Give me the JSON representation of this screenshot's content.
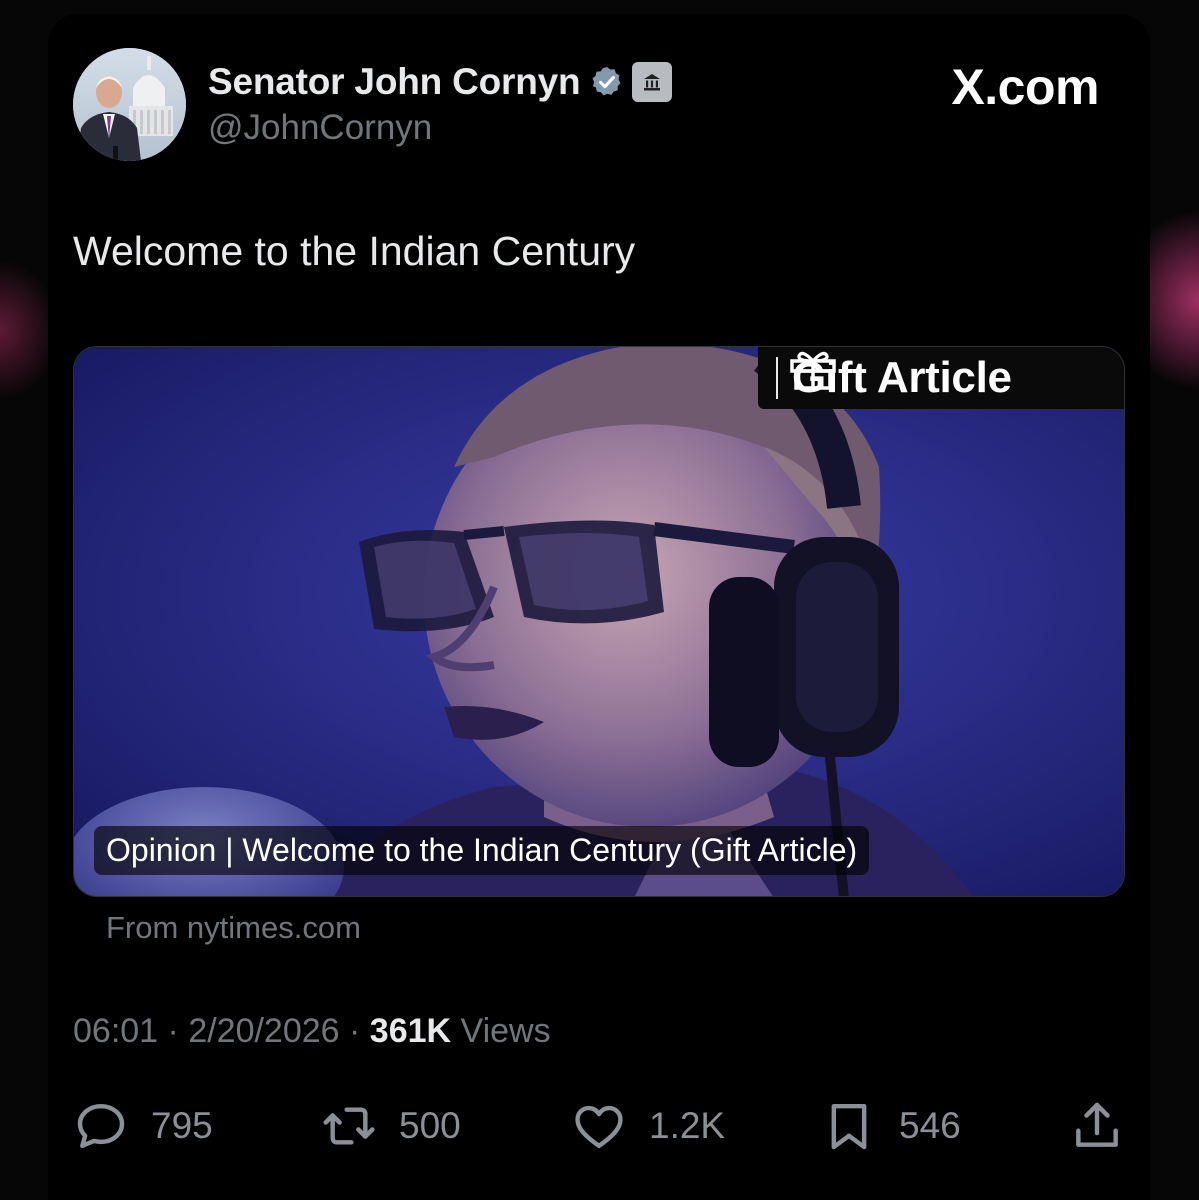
{
  "tweet": {
    "author": {
      "display_name": "Senator John Cornyn",
      "handle": "@JohnCornyn"
    },
    "brand": "X.com",
    "text": "Welcome to the Indian Century",
    "card": {
      "badge_label": "Gift Article",
      "title": "Opinion | Welcome to the Indian Century (Gift Article)",
      "source": "From nytimes.com"
    },
    "meta": {
      "time": "06:01",
      "date": "2/20/2026",
      "views_count": "361K",
      "views_label": "Views"
    },
    "stats": {
      "replies": "795",
      "reposts": "500",
      "likes": "1.2K",
      "bookmarks": "546"
    }
  },
  "icons": {
    "verified": "verified-badge-icon",
    "government": "government-building-icon",
    "gift": "gift-icon",
    "reply": "reply-icon",
    "repost": "repost-icon",
    "like": "heart-icon",
    "bookmark": "bookmark-icon",
    "share": "share-icon"
  },
  "colors": {
    "background": "#000000",
    "primary_text": "#e7e9ea",
    "secondary_text": "#71767b",
    "verified_badge": "#829aab",
    "media_tint": "#2b2d8a"
  }
}
